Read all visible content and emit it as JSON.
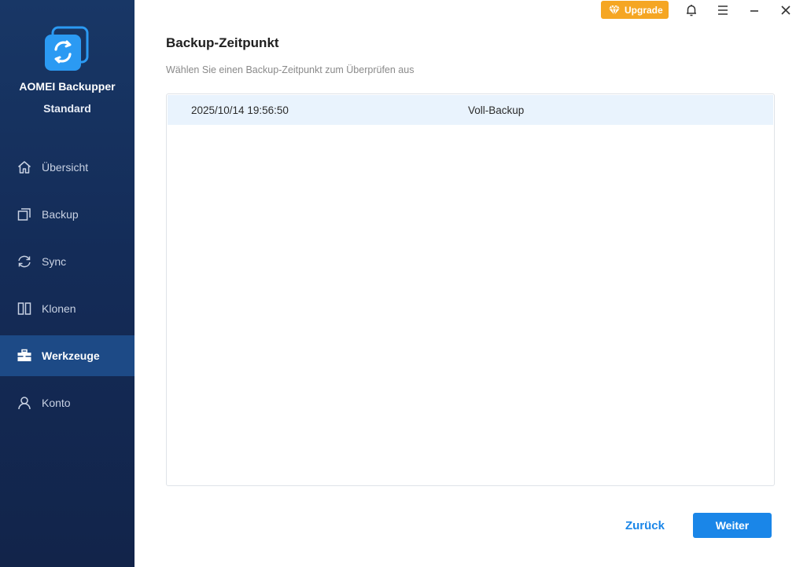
{
  "app": {
    "name": "AOMEI Backupper",
    "edition": "Standard"
  },
  "sidebar": {
    "items": [
      {
        "label": "Übersicht",
        "icon": "home-icon",
        "active": false
      },
      {
        "label": "Backup",
        "icon": "backup-icon",
        "active": false
      },
      {
        "label": "Sync",
        "icon": "sync-icon",
        "active": false
      },
      {
        "label": "Klonen",
        "icon": "clone-icon",
        "active": false
      },
      {
        "label": "Werkzeuge",
        "icon": "toolbox-icon",
        "active": true
      },
      {
        "label": "Konto",
        "icon": "user-icon",
        "active": false
      }
    ]
  },
  "topbar": {
    "upgrade_label": "Upgrade",
    "icons": [
      "bell-icon",
      "menu-icon",
      "minimize-icon",
      "close-icon"
    ]
  },
  "main": {
    "title": "Backup-Zeitpunkt",
    "subtitle": "Wählen Sie einen Backup-Zeitpunkt zum Überprüfen aus",
    "rows": [
      {
        "time": "2025/10/14 19:56:50",
        "type": "Voll-Backup",
        "selected": true
      }
    ]
  },
  "footer": {
    "back_label": "Zurück",
    "next_label": "Weiter"
  },
  "colors": {
    "sidebar_bg": "#142c58",
    "sidebar_active": "#1d4a86",
    "accent_blue": "#1a86e8",
    "upgrade_orange": "#f5a623",
    "row_selected": "#e9f3fd"
  }
}
